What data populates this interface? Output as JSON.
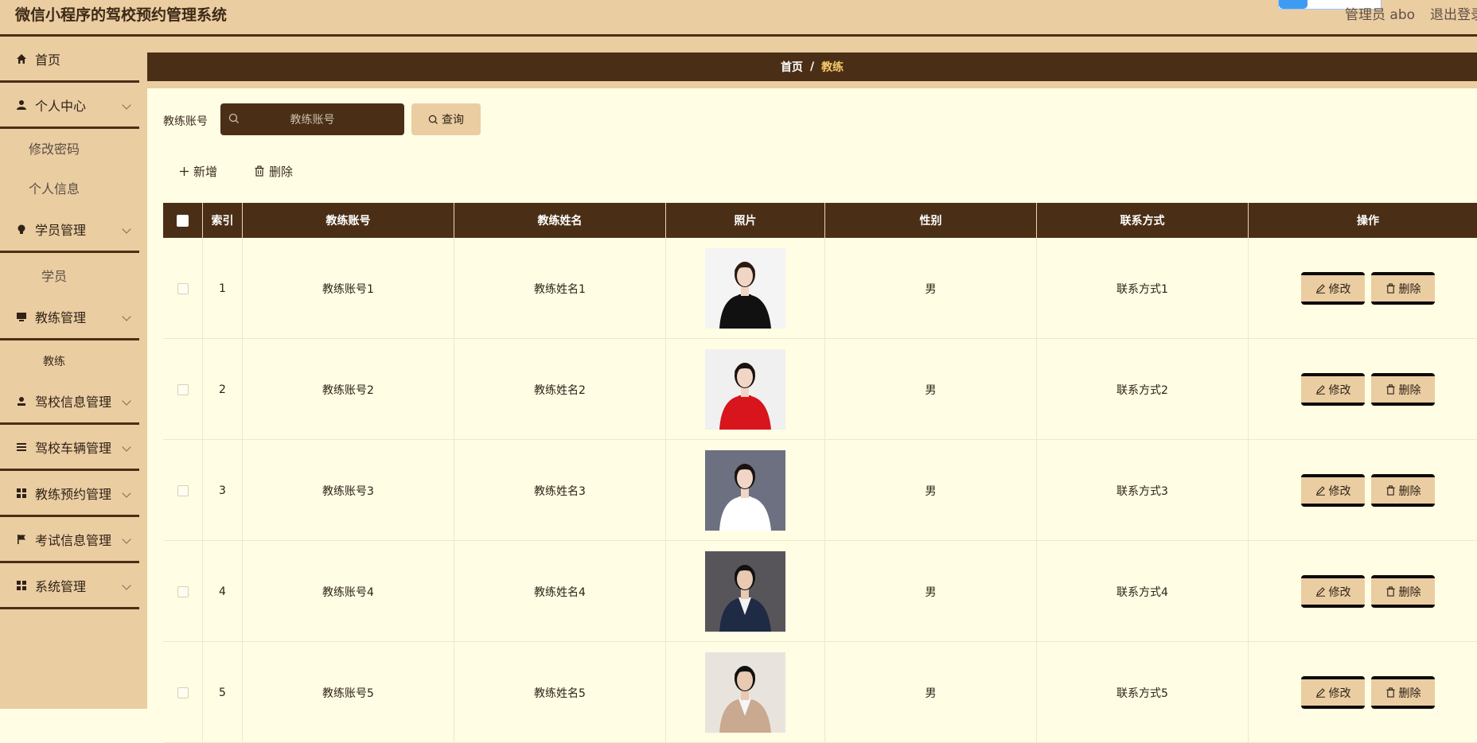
{
  "header": {
    "app_title": "微信小程序的驾校预约管理系统",
    "admin_label": "管理员 abo",
    "logout_label": "退出登录"
  },
  "sidebar": {
    "home": "首页",
    "personal_center": "个人中心",
    "change_password": "修改密码",
    "personal_info": "个人信息",
    "student_mgmt": "学员管理",
    "students": "学员",
    "coach_mgmt": "教练管理",
    "coaches": "教练",
    "school_info_mgmt": "驾校信息管理",
    "vehicle_mgmt": "驾校车辆管理",
    "booking_mgmt": "教练预约管理",
    "exam_mgmt": "考试信息管理",
    "system_mgmt": "系统管理"
  },
  "breadcrumb": {
    "home": "首页",
    "separator": "/",
    "current": "教练"
  },
  "search": {
    "label": "教练账号",
    "placeholder": "教练账号",
    "query_button": "查询"
  },
  "actions": {
    "add": "新增",
    "delete": "删除"
  },
  "table": {
    "headers": {
      "index": "索引",
      "account": "教练账号",
      "name": "教练姓名",
      "photo": "照片",
      "gender": "性别",
      "contact": "联系方式",
      "ops": "操作"
    },
    "edit_label": "修改",
    "delete_label": "删除",
    "rows": [
      {
        "index": "1",
        "account": "教练账号1",
        "name": "教练姓名1",
        "gender": "男",
        "contact": "联系方式1"
      },
      {
        "index": "2",
        "account": "教练账号2",
        "name": "教练姓名2",
        "gender": "男",
        "contact": "联系方式2"
      },
      {
        "index": "3",
        "account": "教练账号3",
        "name": "教练姓名3",
        "gender": "男",
        "contact": "联系方式3"
      },
      {
        "index": "4",
        "account": "教练账号4",
        "name": "教练姓名4",
        "gender": "男",
        "contact": "联系方式4"
      },
      {
        "index": "5",
        "account": "教练账号5",
        "name": "教练姓名5",
        "gender": "男",
        "contact": "联系方式5"
      }
    ]
  },
  "colors": {
    "accent_dark": "#4a2f16",
    "accent_light": "#ebcda2",
    "background": "#fffde3",
    "breadcrumb_current": "#f5c96a"
  }
}
